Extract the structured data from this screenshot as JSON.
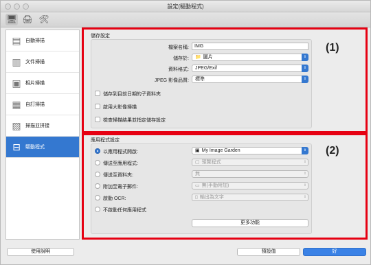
{
  "window": {
    "title": "設定(驅動程式)"
  },
  "toolbar": {
    "icons": [
      "scan-from-computer-icon",
      "scan-from-operation-panel-icon",
      "general-settings-icon"
    ]
  },
  "sidebar": {
    "items": [
      {
        "label": "自動掃描",
        "icon": "auto-scan-icon"
      },
      {
        "label": "文件掃描",
        "icon": "document-scan-icon"
      },
      {
        "label": "相片掃描",
        "icon": "photo-scan-icon"
      },
      {
        "label": "自訂掃描",
        "icon": "custom-scan-icon"
      },
      {
        "label": "掃描並拼接",
        "icon": "scan-and-stitch-icon"
      },
      {
        "label": "驅動程式",
        "icon": "driver-icon",
        "selected": true
      }
    ]
  },
  "save": {
    "section_title": "儲存設定",
    "marker": "(1)",
    "file_name_label": "檔案名稱:",
    "file_name_value": "IMG",
    "save_in_label": "儲存於:",
    "save_in_value": "圖片",
    "data_format_label": "資料格式:",
    "data_format_value": "JPEG/Exif",
    "jpeg_quality_label": "JPEG 影像品質:",
    "jpeg_quality_value": "標準",
    "check_subfolder": "儲存到目前日期的子資料夾",
    "check_large_image": "啟用大影像掃描",
    "check_results": "檢查掃描結果並指定儲存設定"
  },
  "app": {
    "section_title": "應用程式設定",
    "marker": "(2)",
    "opt_open": "以應用程式開啟:",
    "opt_open_value": "My Image Garden",
    "opt_send_app": "傳送至應用程式:",
    "opt_send_app_value": "預覽程式",
    "opt_send_folder": "傳送至資料夾:",
    "opt_send_folder_value": "無",
    "opt_email": "附加至電子郵件:",
    "opt_email_value": "無(手動附加)",
    "opt_ocr": "啟動 OCR:",
    "opt_ocr_value": "輸出為文字",
    "opt_none": "不啟動任何應用程式",
    "more_button": "更多功能"
  },
  "footer": {
    "help_button": "使用說明",
    "defaults_button": "預設值",
    "ok_button": "好"
  },
  "colors": {
    "accent": "#3478d0",
    "highlight_border": "#e60012"
  }
}
